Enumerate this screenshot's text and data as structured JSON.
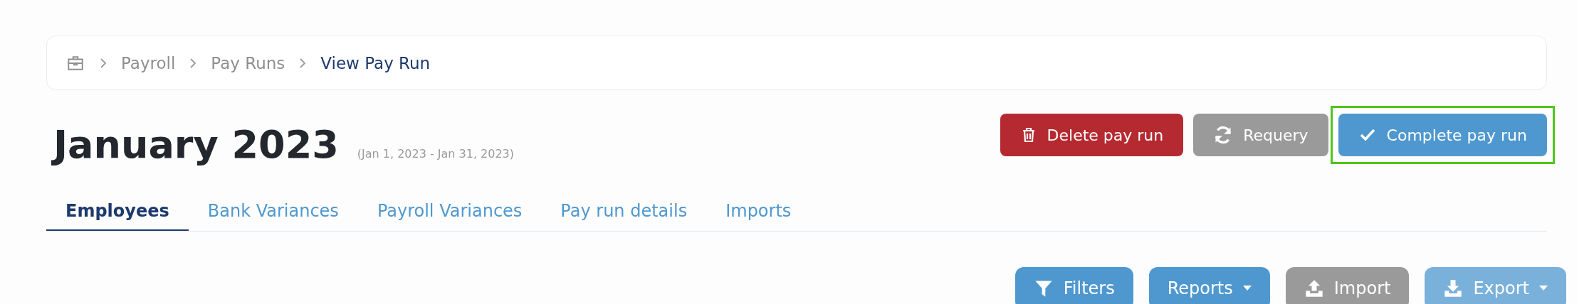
{
  "breadcrumb": [
    {
      "label": "Payroll",
      "current": false
    },
    {
      "label": "Pay Runs",
      "current": false
    },
    {
      "label": "View Pay Run",
      "current": true
    }
  ],
  "page": {
    "title": "January 2023",
    "date_range": "(Jan 1, 2023 - Jan 31, 2023)"
  },
  "actions": [
    {
      "label": "Delete pay run",
      "kind": "danger",
      "highlighted": false
    },
    {
      "label": "Requery",
      "kind": "secondary",
      "highlighted": false
    },
    {
      "label": "Complete pay run",
      "kind": "primary",
      "highlighted": true
    }
  ],
  "tabs": [
    {
      "label": "Employees",
      "selected": true
    },
    {
      "label": "Bank Variances",
      "selected": false
    },
    {
      "label": "Payroll Variances",
      "selected": false
    },
    {
      "label": "Pay run details",
      "selected": false
    },
    {
      "label": "Imports",
      "selected": false
    }
  ],
  "toolbar": [
    {
      "label": "Filters",
      "kind": "primary",
      "dropdown": false,
      "disabled": false
    },
    {
      "label": "Reports",
      "kind": "primary",
      "dropdown": true,
      "disabled": false
    },
    {
      "label": "Import",
      "kind": "secondary",
      "dropdown": false,
      "disabled": false
    },
    {
      "label": "Export",
      "kind": "primary",
      "dropdown": true,
      "disabled": true
    }
  ]
}
